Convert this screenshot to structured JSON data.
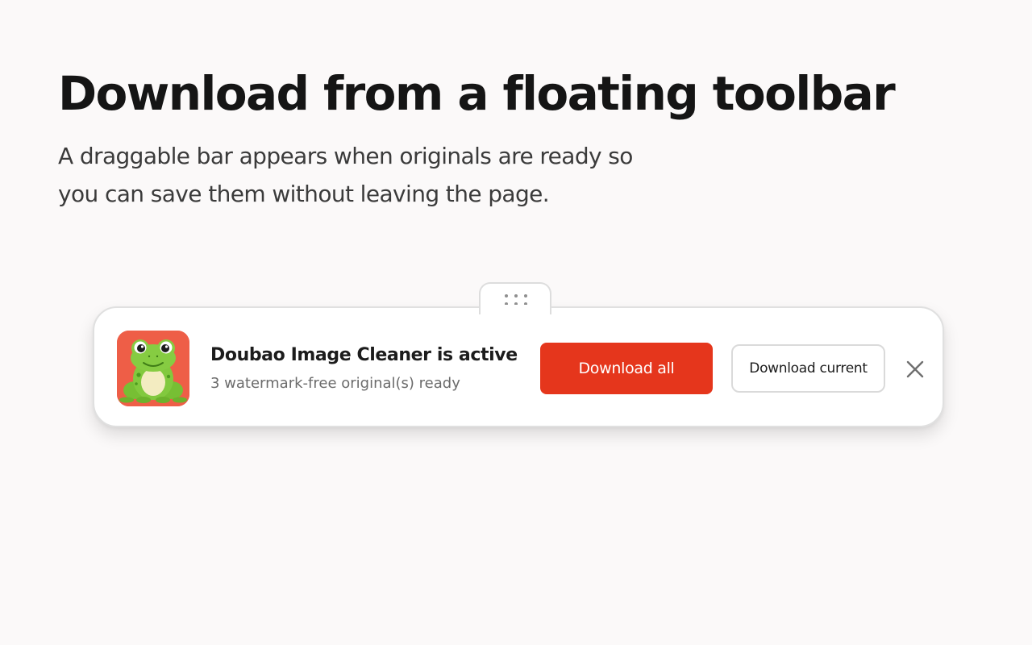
{
  "hero": {
    "title": "Download from a floating toolbar",
    "subtitle": "A draggable bar appears when originals are ready so you can save them without leaving the page."
  },
  "toolbar": {
    "drag_handle_icon": "drag-dots-icon",
    "app_icon": "frog-app-icon",
    "status_title": "Doubao Image Cleaner is active",
    "status_subtitle": "3 watermark-free original(s) ready",
    "download_all_label": "Download all",
    "download_current_label": "Download current",
    "close_icon": "close-icon"
  },
  "colors": {
    "background": "#fbf9f9",
    "primary_button": "#e5361c",
    "app_icon_background": "#ee5e47",
    "frog_green": "#7cc43a"
  }
}
